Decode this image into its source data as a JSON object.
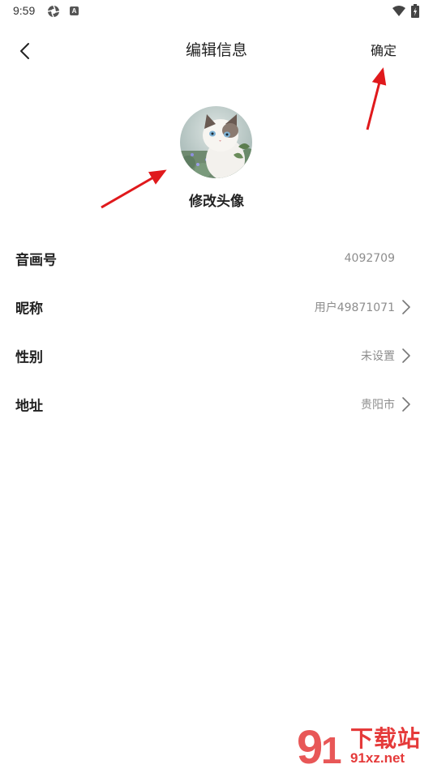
{
  "status_bar": {
    "time": "9:59",
    "notification_badge_letter": "A",
    "icons": [
      "aperture-icon",
      "notification-icon",
      "wifi-icon",
      "battery-icon"
    ]
  },
  "header": {
    "title": "编辑信息",
    "confirm_label": "确定",
    "back_icon": "chevron-left-icon"
  },
  "profile": {
    "avatar_caption": "修改头像"
  },
  "rows": [
    {
      "label": "音画号",
      "value": "4092709",
      "has_chevron": false
    },
    {
      "label": "昵称",
      "value": "用户49871071",
      "has_chevron": true
    },
    {
      "label": "性别",
      "value": "未设置",
      "has_chevron": true
    },
    {
      "label": "地址",
      "value": "贵阳市",
      "has_chevron": true
    }
  ],
  "colors": {
    "background": "#ffffff",
    "primary_text": "#222222",
    "secondary_text": "#8d8d8d",
    "annotation_arrow": "#e0191c"
  },
  "watermark": {
    "site_name": "下载站",
    "site_domain": "91xz.net"
  }
}
